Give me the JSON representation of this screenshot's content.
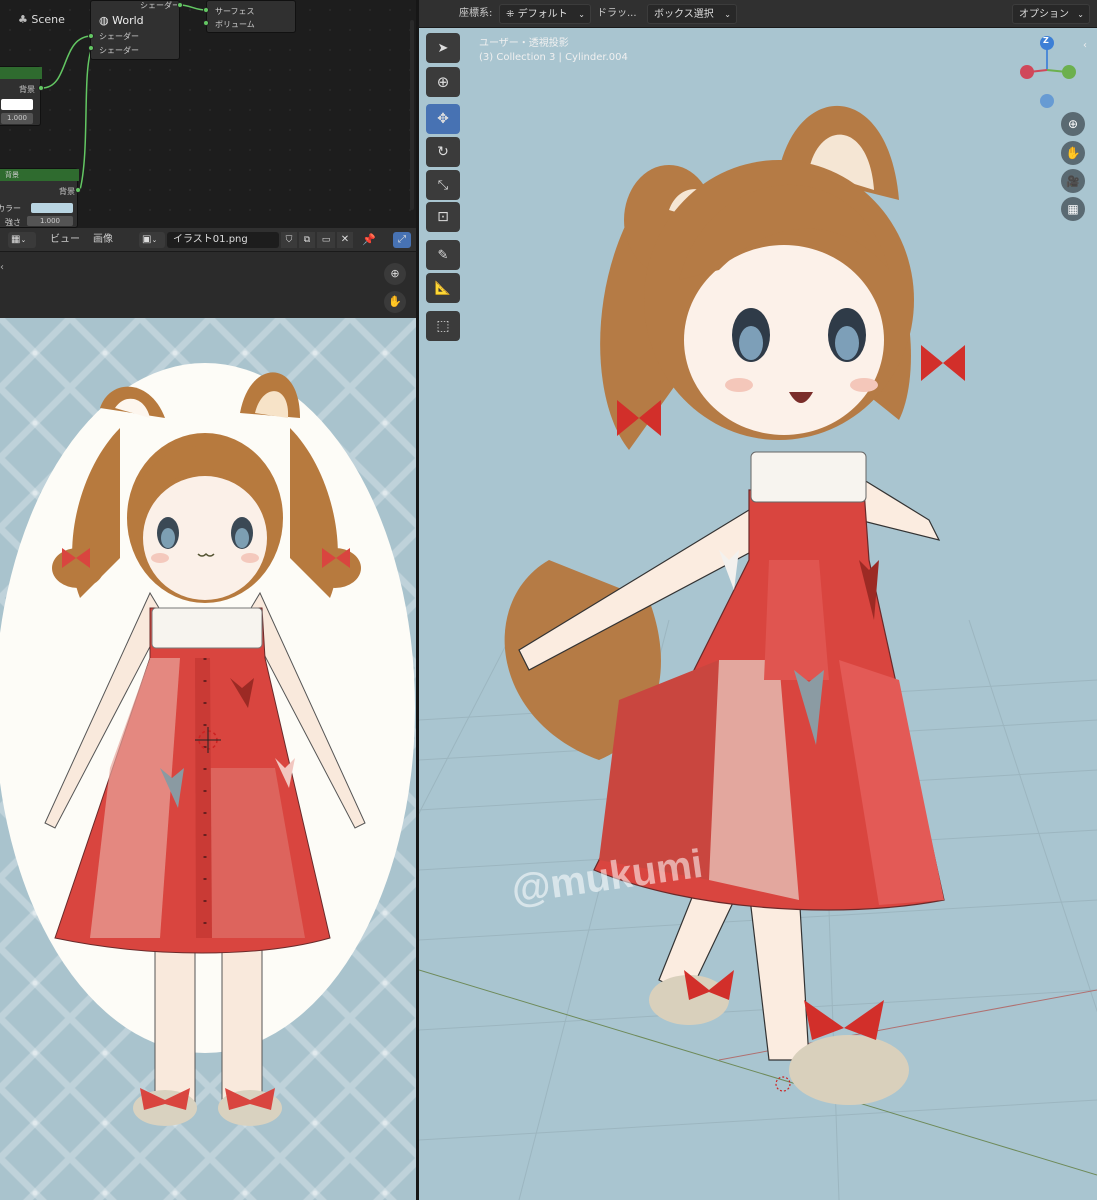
{
  "node_editor": {
    "scene_label": "Scene",
    "world_node": {
      "title": "World",
      "sockets": [
        "シェーダー",
        "シェーダー"
      ]
    },
    "output_node": {
      "top_label": "シェーダー",
      "sockets": [
        "サーフェス",
        "ボリューム"
      ]
    },
    "bg_node_1": {
      "label": "背景",
      "value": "1.000"
    },
    "bg_node_2": {
      "header": "背景",
      "out_label": "背景",
      "color_label": "カラー",
      "strength_label": "強さ",
      "strength_value": "1.000"
    }
  },
  "image_editor": {
    "menu": [
      "ビュー",
      "画像"
    ],
    "image_name": "イラスト01.png"
  },
  "viewport": {
    "header": {
      "coord_label": "座標系:",
      "coord_value": "デフォルト",
      "drag_label": "ドラッ...",
      "select_mode": "ボックス選択",
      "options": "オプション"
    },
    "overlay_line1": "ユーザー・透視投影",
    "overlay_line2": "(3) Collection 3 | Cylinder.004",
    "gizmo_axis_label": "Z",
    "watermark": "@mukumi"
  },
  "colors": {
    "accent": "#4772b3",
    "node_green": "#63c763",
    "viewport_bg": "#a9c5d0",
    "dress_red": "#d9453f"
  }
}
